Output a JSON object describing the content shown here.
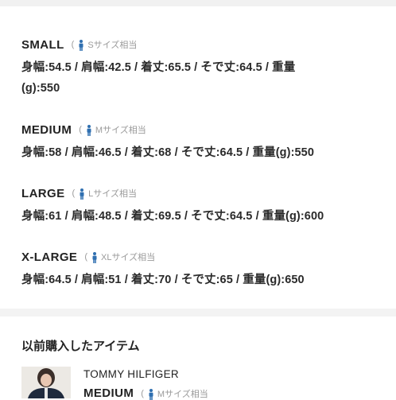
{
  "sizes": [
    {
      "name": "SMALL",
      "equiv": "Sサイズ相当",
      "text": "身幅:54.5 / 肩幅:42.5 / 着丈:65.5 / そで丈:64.5 / 重量\n(g):550"
    },
    {
      "name": "MEDIUM",
      "equiv": "Mサイズ相当",
      "text": "身幅:58 / 肩幅:46.5 / 着丈:68 / そで丈:64.5 / 重量(g):550"
    },
    {
      "name": "LARGE",
      "equiv": "Lサイズ相当",
      "text": "身幅:61 / 肩幅:48.5 / 着丈:69.5 / そで丈:64.5 / 重量(g):600"
    },
    {
      "name": "X-LARGE",
      "equiv": "XLサイズ相当",
      "text": "身幅:64.5 / 肩幅:51 / 着丈:70 / そで丈:65 / 重量(g):650"
    }
  ],
  "paren_open": "(",
  "purchased": {
    "title": "以前購入したアイテム",
    "brand": "TOMMY HILFIGER",
    "size_name": "MEDIUM",
    "size_equiv": "Mサイズ相当"
  },
  "colors": {
    "person_icon": "#2f6fb0"
  },
  "icons": {
    "size_equiv": "person-icon",
    "product": "product-thumbnail"
  }
}
